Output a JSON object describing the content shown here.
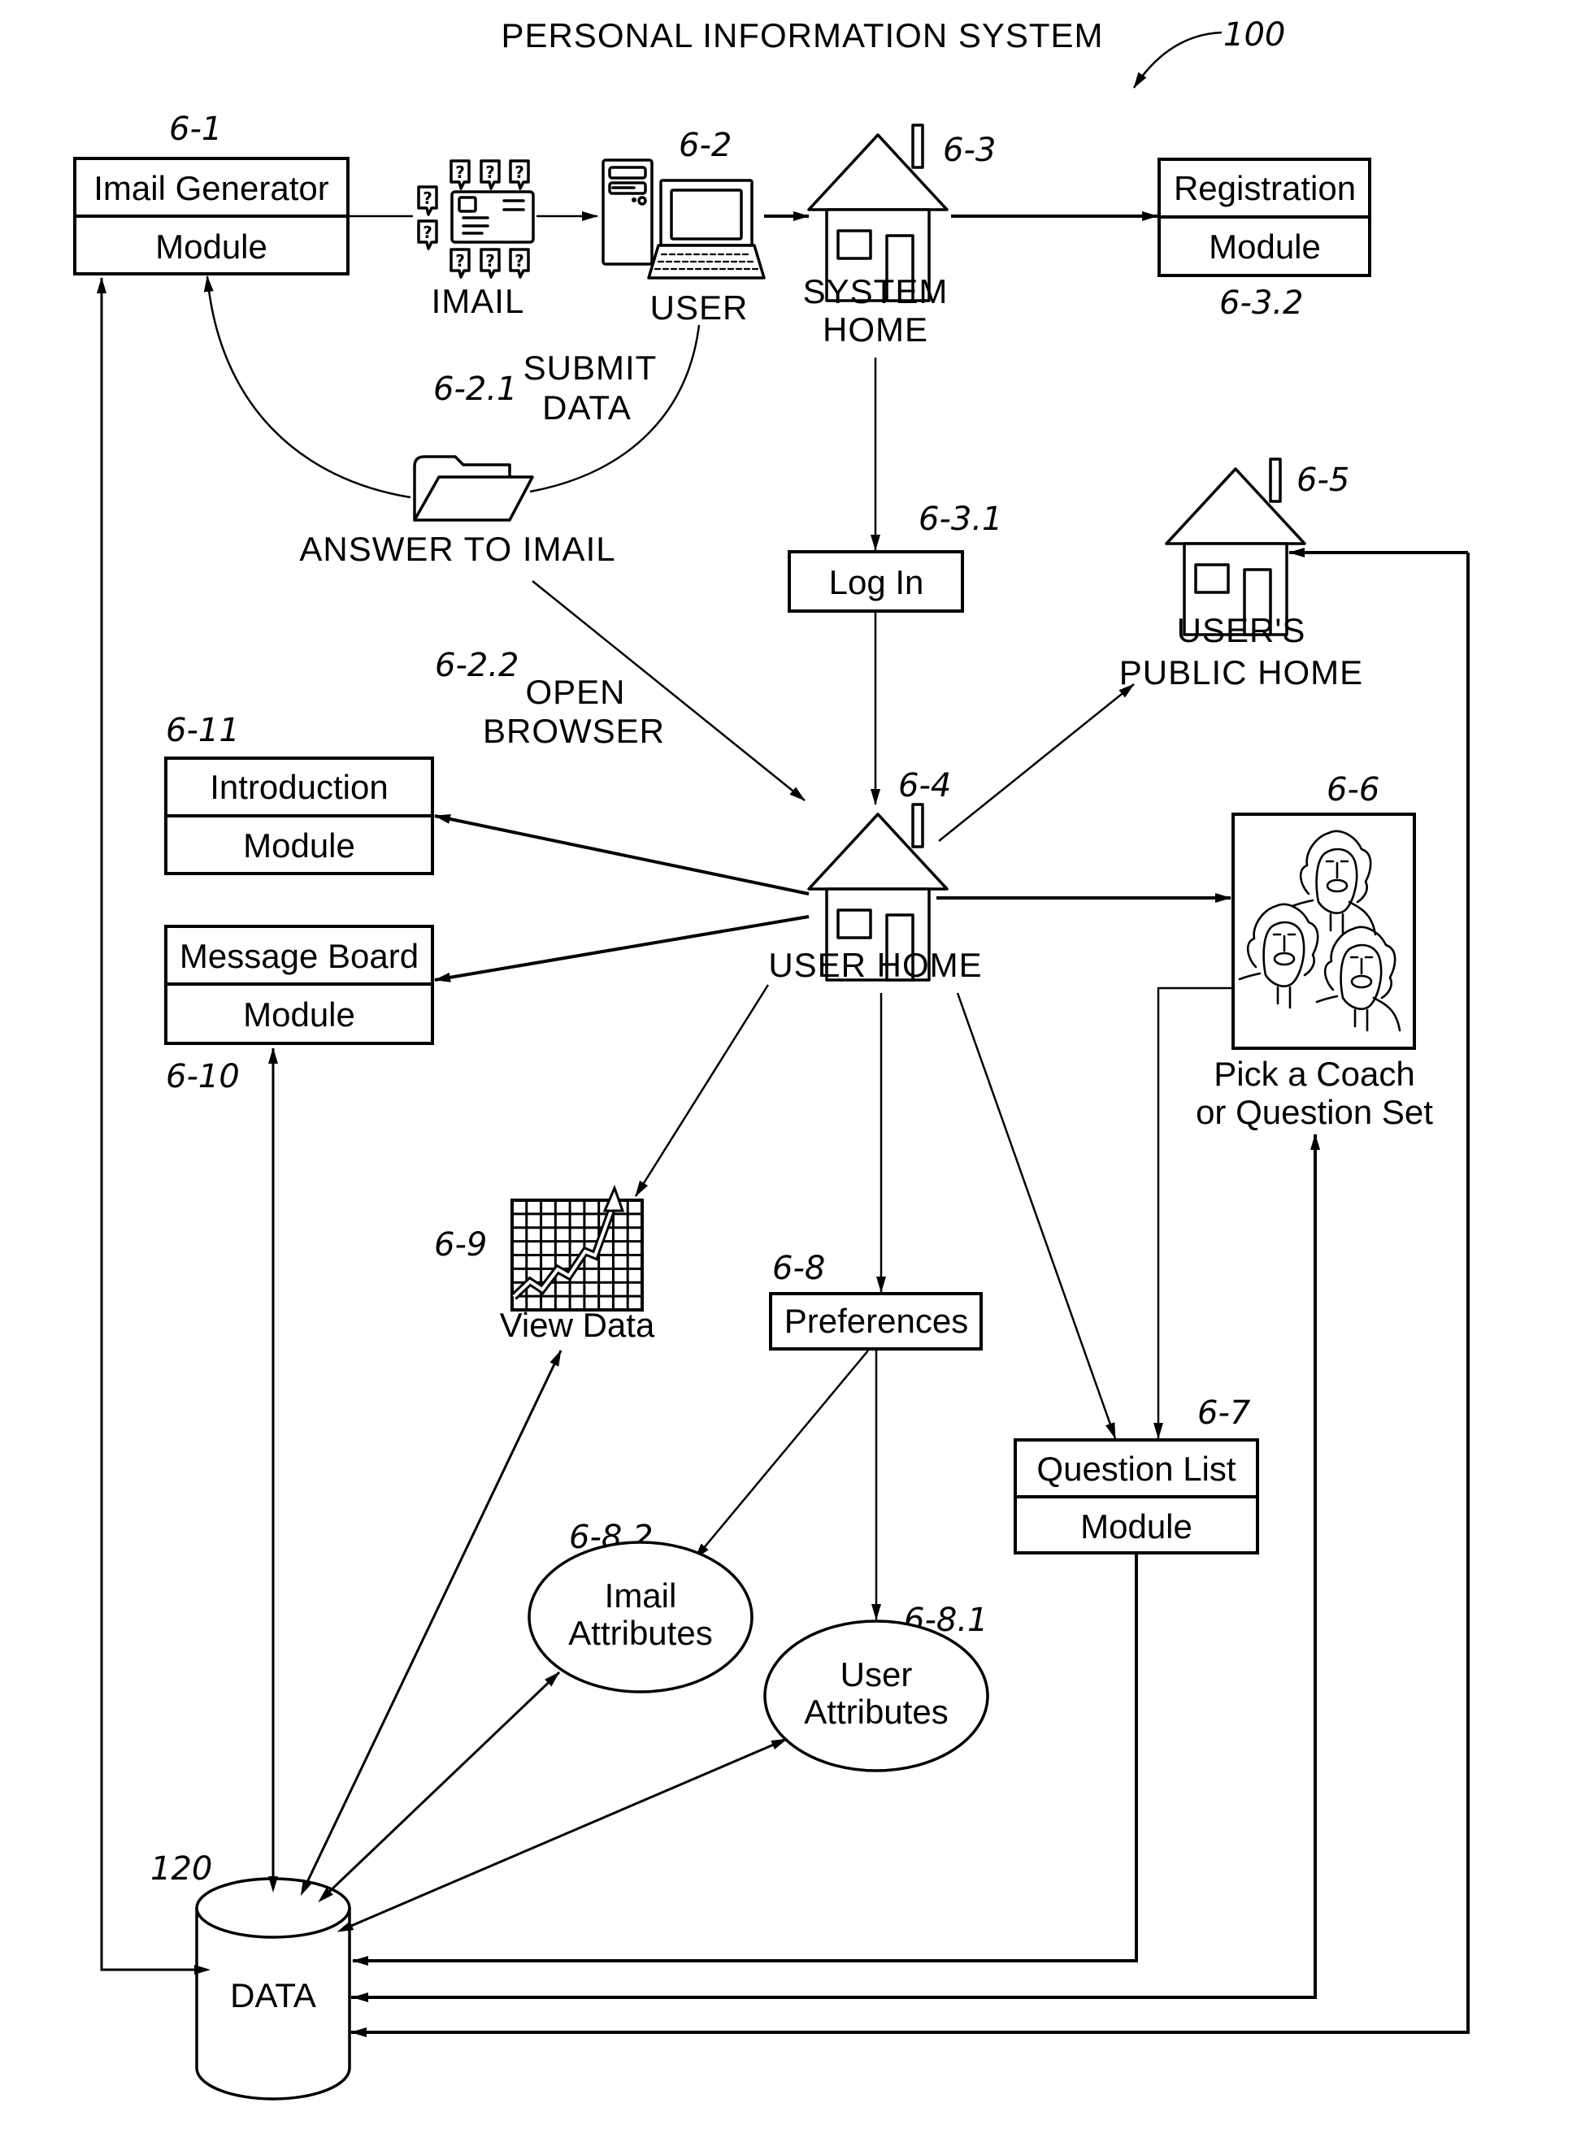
{
  "title": "PERSONAL INFORMATION SYSTEM",
  "system_ref": "100",
  "colors": {
    "ink": "#000000",
    "paper": "#ffffff"
  },
  "nodes": {
    "imail_generator": {
      "ref": "6-1",
      "line1": "Imail Generator",
      "line2": "Module"
    },
    "imail": {
      "label": "IMAIL",
      "icon": "imail-envelope-icon"
    },
    "user": {
      "ref": "6-2",
      "label": "USER",
      "icon": "computer-icon"
    },
    "system_home": {
      "ref": "6-3",
      "line1": "SYSTEM",
      "line2": "HOME",
      "icon": "house-icon"
    },
    "registration": {
      "ref": "6-3.2",
      "line1": "Registration",
      "line2": "Module"
    },
    "submit_data": {
      "ref": "6-2.1",
      "line1": "SUBMIT",
      "line2": "DATA"
    },
    "answer_to_imail": {
      "label": "ANSWER TO IMAIL",
      "icon": "folder-icon"
    },
    "log_in": {
      "ref": "6-3.1",
      "label": "Log In"
    },
    "public_home": {
      "ref": "6-5",
      "line1": "USER'S",
      "line2": "PUBLIC HOME",
      "icon": "house-icon"
    },
    "open_browser": {
      "ref": "6-2.2",
      "line1": "OPEN",
      "line2": "BROWSER"
    },
    "introduction": {
      "ref": "6-11",
      "line1": "Introduction",
      "line2": "Module"
    },
    "user_home": {
      "ref": "6-4",
      "label": "USER HOME",
      "icon": "house-icon"
    },
    "message_board": {
      "ref": "6-10",
      "line1": "Message Board",
      "line2": "Module"
    },
    "coach": {
      "ref": "6-6",
      "line1": "Pick a Coach",
      "line2": "or Question Set",
      "icon": "coaches-faces-icon"
    },
    "view_data": {
      "ref": "6-9",
      "label": "View Data",
      "icon": "chart-icon"
    },
    "preferences": {
      "ref": "6-8",
      "label": "Preferences"
    },
    "question_list": {
      "ref": "6-7",
      "line1": "Question List",
      "line2": "Module"
    },
    "imail_attributes": {
      "ref": "6-8.2",
      "line1": "Imail",
      "line2": "Attributes"
    },
    "user_attributes": {
      "ref": "6-8.1",
      "line1": "User",
      "line2": "Attributes"
    },
    "data": {
      "ref": "120",
      "label": "DATA",
      "icon": "database-cylinder-icon"
    }
  },
  "connections": [
    {
      "from": "imail_generator",
      "to": "imail"
    },
    {
      "from": "imail",
      "to": "user"
    },
    {
      "from": "user",
      "to": "system_home"
    },
    {
      "from": "system_home",
      "to": "registration"
    },
    {
      "from": "user",
      "to": "imail_generator",
      "via": "answer_to_imail",
      "label": "6-2.1 SUBMIT DATA"
    },
    {
      "from": "answer_to_imail",
      "to": "user_home",
      "label": "6-2.2 OPEN BROWSER"
    },
    {
      "from": "system_home",
      "to": "log_in"
    },
    {
      "from": "log_in",
      "to": "user_home"
    },
    {
      "from": "user_home",
      "to": "public_home"
    },
    {
      "from": "user_home",
      "to": "introduction"
    },
    {
      "from": "user_home",
      "to": "message_board"
    },
    {
      "from": "user_home",
      "to": "coach"
    },
    {
      "from": "user_home",
      "to": "view_data"
    },
    {
      "from": "user_home",
      "to": "preferences"
    },
    {
      "from": "user_home",
      "to": "question_list"
    },
    {
      "from": "coach",
      "to": "question_list"
    },
    {
      "from": "preferences",
      "to": "imail_attributes"
    },
    {
      "from": "preferences",
      "to": "user_attributes"
    },
    {
      "from": "data",
      "to": "imail_generator",
      "bidirectional": true
    },
    {
      "from": "data",
      "to": "message_board",
      "bidirectional": true
    },
    {
      "from": "data",
      "to": "view_data",
      "bidirectional": true
    },
    {
      "from": "data",
      "to": "imail_attributes",
      "bidirectional": true
    },
    {
      "from": "data",
      "to": "user_attributes",
      "bidirectional": true
    },
    {
      "from": "question_list",
      "to": "data"
    },
    {
      "from": "data",
      "to": "coach"
    },
    {
      "from": "data",
      "to": "public_home"
    }
  ]
}
